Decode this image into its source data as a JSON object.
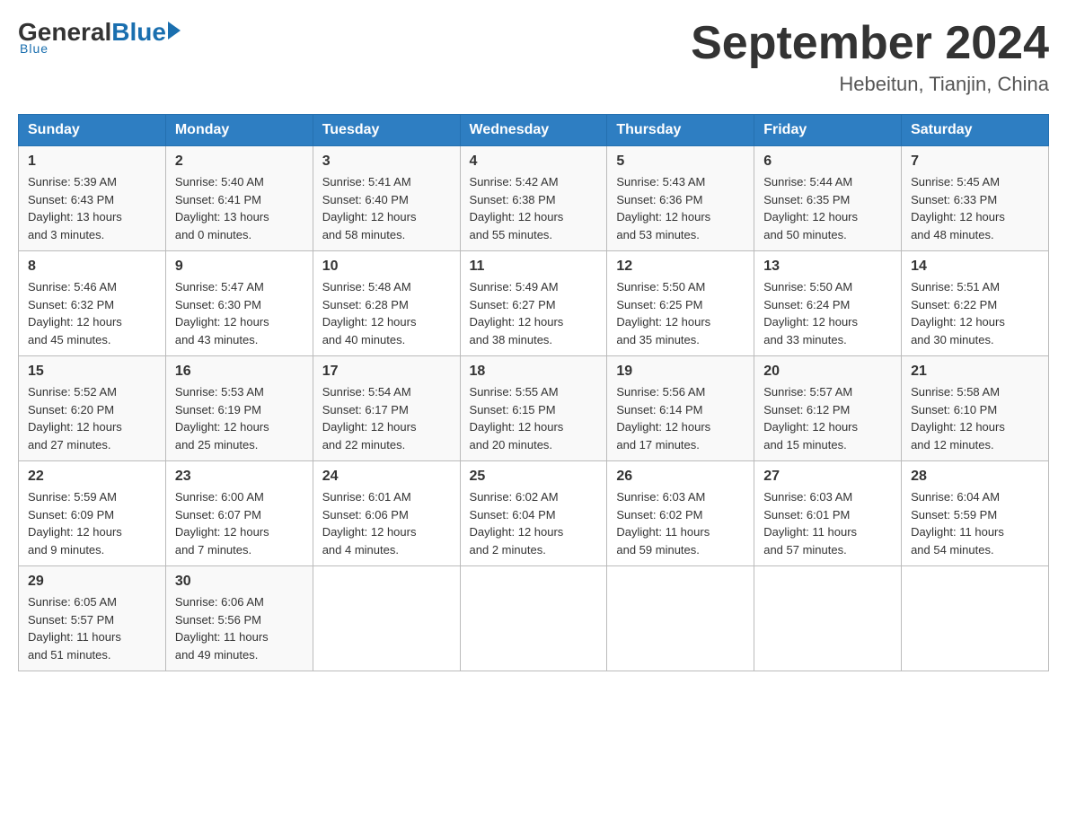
{
  "header": {
    "logo": {
      "general": "General",
      "blue": "Blue",
      "tagline": "Blue"
    },
    "title": "September 2024",
    "subtitle": "Hebeitun, Tianjin, China"
  },
  "days_of_week": [
    "Sunday",
    "Monday",
    "Tuesday",
    "Wednesday",
    "Thursday",
    "Friday",
    "Saturday"
  ],
  "weeks": [
    [
      {
        "day": "1",
        "sunrise": "5:39 AM",
        "sunset": "6:43 PM",
        "daylight": "13 hours and 3 minutes."
      },
      {
        "day": "2",
        "sunrise": "5:40 AM",
        "sunset": "6:41 PM",
        "daylight": "13 hours and 0 minutes."
      },
      {
        "day": "3",
        "sunrise": "5:41 AM",
        "sunset": "6:40 PM",
        "daylight": "12 hours and 58 minutes."
      },
      {
        "day": "4",
        "sunrise": "5:42 AM",
        "sunset": "6:38 PM",
        "daylight": "12 hours and 55 minutes."
      },
      {
        "day": "5",
        "sunrise": "5:43 AM",
        "sunset": "6:36 PM",
        "daylight": "12 hours and 53 minutes."
      },
      {
        "day": "6",
        "sunrise": "5:44 AM",
        "sunset": "6:35 PM",
        "daylight": "12 hours and 50 minutes."
      },
      {
        "day": "7",
        "sunrise": "5:45 AM",
        "sunset": "6:33 PM",
        "daylight": "12 hours and 48 minutes."
      }
    ],
    [
      {
        "day": "8",
        "sunrise": "5:46 AM",
        "sunset": "6:32 PM",
        "daylight": "12 hours and 45 minutes."
      },
      {
        "day": "9",
        "sunrise": "5:47 AM",
        "sunset": "6:30 PM",
        "daylight": "12 hours and 43 minutes."
      },
      {
        "day": "10",
        "sunrise": "5:48 AM",
        "sunset": "6:28 PM",
        "daylight": "12 hours and 40 minutes."
      },
      {
        "day": "11",
        "sunrise": "5:49 AM",
        "sunset": "6:27 PM",
        "daylight": "12 hours and 38 minutes."
      },
      {
        "day": "12",
        "sunrise": "5:50 AM",
        "sunset": "6:25 PM",
        "daylight": "12 hours and 35 minutes."
      },
      {
        "day": "13",
        "sunrise": "5:50 AM",
        "sunset": "6:24 PM",
        "daylight": "12 hours and 33 minutes."
      },
      {
        "day": "14",
        "sunrise": "5:51 AM",
        "sunset": "6:22 PM",
        "daylight": "12 hours and 30 minutes."
      }
    ],
    [
      {
        "day": "15",
        "sunrise": "5:52 AM",
        "sunset": "6:20 PM",
        "daylight": "12 hours and 27 minutes."
      },
      {
        "day": "16",
        "sunrise": "5:53 AM",
        "sunset": "6:19 PM",
        "daylight": "12 hours and 25 minutes."
      },
      {
        "day": "17",
        "sunrise": "5:54 AM",
        "sunset": "6:17 PM",
        "daylight": "12 hours and 22 minutes."
      },
      {
        "day": "18",
        "sunrise": "5:55 AM",
        "sunset": "6:15 PM",
        "daylight": "12 hours and 20 minutes."
      },
      {
        "day": "19",
        "sunrise": "5:56 AM",
        "sunset": "6:14 PM",
        "daylight": "12 hours and 17 minutes."
      },
      {
        "day": "20",
        "sunrise": "5:57 AM",
        "sunset": "6:12 PM",
        "daylight": "12 hours and 15 minutes."
      },
      {
        "day": "21",
        "sunrise": "5:58 AM",
        "sunset": "6:10 PM",
        "daylight": "12 hours and 12 minutes."
      }
    ],
    [
      {
        "day": "22",
        "sunrise": "5:59 AM",
        "sunset": "6:09 PM",
        "daylight": "12 hours and 9 minutes."
      },
      {
        "day": "23",
        "sunrise": "6:00 AM",
        "sunset": "6:07 PM",
        "daylight": "12 hours and 7 minutes."
      },
      {
        "day": "24",
        "sunrise": "6:01 AM",
        "sunset": "6:06 PM",
        "daylight": "12 hours and 4 minutes."
      },
      {
        "day": "25",
        "sunrise": "6:02 AM",
        "sunset": "6:04 PM",
        "daylight": "12 hours and 2 minutes."
      },
      {
        "day": "26",
        "sunrise": "6:03 AM",
        "sunset": "6:02 PM",
        "daylight": "11 hours and 59 minutes."
      },
      {
        "day": "27",
        "sunrise": "6:03 AM",
        "sunset": "6:01 PM",
        "daylight": "11 hours and 57 minutes."
      },
      {
        "day": "28",
        "sunrise": "6:04 AM",
        "sunset": "5:59 PM",
        "daylight": "11 hours and 54 minutes."
      }
    ],
    [
      {
        "day": "29",
        "sunrise": "6:05 AM",
        "sunset": "5:57 PM",
        "daylight": "11 hours and 51 minutes."
      },
      {
        "day": "30",
        "sunrise": "6:06 AM",
        "sunset": "5:56 PM",
        "daylight": "11 hours and 49 minutes."
      },
      null,
      null,
      null,
      null,
      null
    ]
  ],
  "labels": {
    "sunrise": "Sunrise:",
    "sunset": "Sunset:",
    "daylight": "Daylight:"
  }
}
